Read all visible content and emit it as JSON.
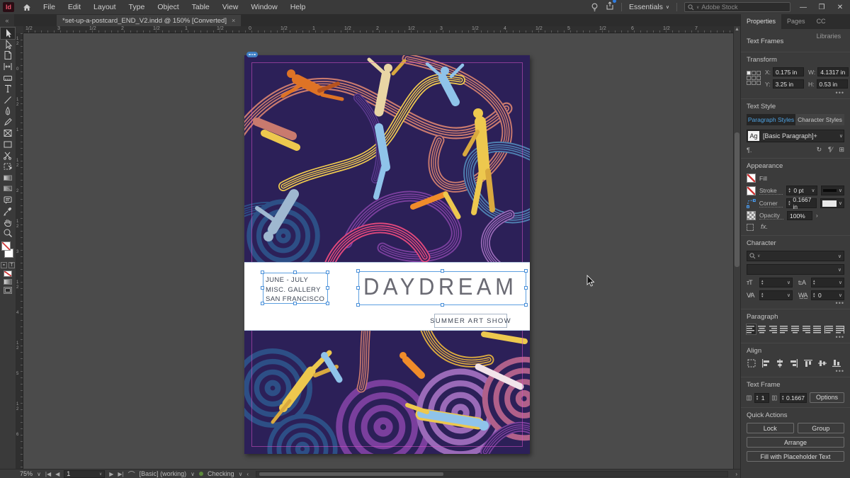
{
  "app": {
    "logo": "Id",
    "workspace": "Essentials",
    "search_placeholder": "Adobe Stock"
  },
  "menubar": {
    "items": [
      "File",
      "Edit",
      "Layout",
      "Type",
      "Object",
      "Table",
      "View",
      "Window",
      "Help"
    ]
  },
  "window_controls": {
    "minimize": "—",
    "restore": "❐",
    "close": "✕"
  },
  "document_tab": {
    "title": "*set-up-a-postcard_END_V2.indd @ 150% [Converted]",
    "close": "×"
  },
  "rulers": {
    "horizontal_labels": [
      "1/2",
      "3",
      "1/2",
      "2",
      "1/2",
      "1",
      "1/2",
      "0",
      "1/2",
      "1",
      "1/2",
      "2",
      "1/2",
      "3",
      "1/2",
      "4",
      "1/2",
      "5",
      "1/2",
      "6",
      "1/2",
      "7"
    ],
    "vertical_labels": [
      "1/2",
      "0",
      "1/2",
      "1",
      "1/2",
      "2",
      "1/2",
      "3",
      "1/2",
      "4",
      "1/2",
      "5",
      "1/2",
      "6"
    ]
  },
  "tools": [
    "selection",
    "direct-selection",
    "page",
    "gap",
    "content-collector",
    "type",
    "line",
    "pen",
    "pencil",
    "frame",
    "rectangle",
    "scissors",
    "free-transform",
    "gradient-swatch",
    "gradient-feather",
    "note",
    "eyedropper",
    "hand",
    "zoom"
  ],
  "postcard": {
    "dates_line1": "JUNE - JULY",
    "dates_line2": "MISC. GALLERY",
    "dates_line3": "SAN FRANCISCO",
    "title": "DAYDREAM",
    "subtitle": "SUMMER ART SHOW"
  },
  "artwork": {
    "description": "Illustration of floating figures among swirling striped ribbons on dark indigo background",
    "palette": {
      "background": "#2c2058",
      "salmon": "#c97a6e",
      "magenta": "#e0487c",
      "blue": "#4e7fb0",
      "dark_blue": "#2d4f86",
      "purple": "#7a3f9d",
      "light_purple": "#9a6ab8",
      "violet": "#5b3a8e",
      "yellow": "#edc84e",
      "gold": "#d9a93f",
      "orange": "#de7325",
      "bright_orange": "#f08c2a",
      "cream": "#e8d5a4",
      "light_blue": "#8fc3ea",
      "pale_blue": "#9fb8d0",
      "pale_pink": "#f2e4ea",
      "mauve": "#b0608a"
    }
  },
  "properties_panel": {
    "tabs": [
      "Properties",
      "Pages",
      "CC Libraries"
    ],
    "active_tab": "Properties",
    "selection_type": "Text Frames",
    "transform": {
      "label": "Transform",
      "x_label": "X:",
      "x": "0.175 in",
      "y_label": "Y:",
      "y": "3.25 in",
      "w_label": "W:",
      "w": "4.1317 in",
      "h_label": "H:",
      "h": "0.53 in"
    },
    "text_style": {
      "label": "Text Style",
      "tabs": [
        "Paragraph Styles",
        "Character Styles"
      ],
      "active": "Paragraph Styles",
      "style_badge": "Ag",
      "style_name": "[Basic Paragraph]+"
    },
    "appearance": {
      "label": "Appearance",
      "fill_label": "Fill",
      "stroke_label": "Stroke",
      "stroke_weight": "0 pt",
      "corner_label": "Corner",
      "corner_radius": "0.1667 in",
      "opacity_label": "Opacity",
      "opacity": "100%",
      "fx_label": "fx."
    },
    "character": {
      "label": "Character",
      "tracking": "0"
    },
    "paragraph": {
      "label": "Paragraph"
    },
    "align": {
      "label": "Align"
    },
    "text_frame": {
      "label": "Text Frame",
      "columns": "1",
      "gutter": "0.1667",
      "options_label": "Options"
    },
    "quick_actions": {
      "label": "Quick Actions",
      "buttons": [
        "Lock",
        "Group",
        "Arrange",
        "Fill with Placeholder Text"
      ]
    }
  },
  "statusbar": {
    "zoom": "75%",
    "page": "1",
    "preset": "[Basic] (working)",
    "preflight": "Checking"
  },
  "colors": {
    "accent_blue": "#4fa3e3",
    "selection_blue": "#5d9fe0",
    "margin_guide": "#d852c8",
    "preflight_green": "#5d8a3c"
  }
}
